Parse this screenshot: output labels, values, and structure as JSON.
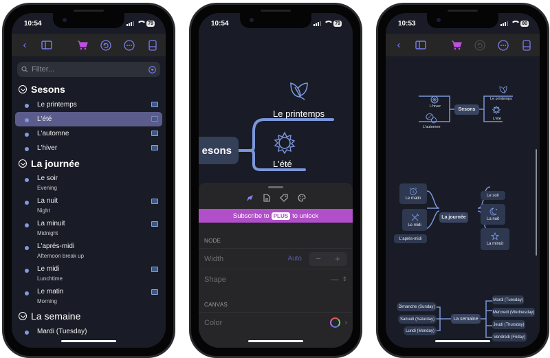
{
  "phones": [
    {
      "status": {
        "time": "10:54",
        "battery": "79"
      },
      "toolbar": {
        "icons": [
          "back-icon",
          "sidebar-icon",
          "cart-icon",
          "undo-icon",
          "more-icon",
          "device-icon"
        ]
      },
      "filter": {
        "placeholder": "Filter..."
      },
      "outline": [
        {
          "title": "Sesons",
          "items": [
            {
              "label": "Le printemps",
              "sub": "",
              "has_image": true
            },
            {
              "label": "L'été",
              "sub": "",
              "has_image": true,
              "selected": true
            },
            {
              "label": "L'automne",
              "sub": "",
              "has_image": true
            },
            {
              "label": "L'hiver",
              "sub": "",
              "has_image": true
            }
          ]
        },
        {
          "title": "La journée",
          "items": [
            {
              "label": "Le soir",
              "sub": "Evening",
              "has_image": false
            },
            {
              "label": "La nuit",
              "sub": "Night",
              "has_image": true
            },
            {
              "label": "La minuit",
              "sub": "Midnight",
              "has_image": true
            },
            {
              "label": "L'aprés-midi",
              "sub": "Afternoon break up",
              "has_image": false
            },
            {
              "label": "Le midi",
              "sub": "Lunchtime",
              "has_image": true
            },
            {
              "label": "Le matin",
              "sub": "Morning",
              "has_image": true
            }
          ]
        },
        {
          "title": "La semaine",
          "items": [
            {
              "label": "Mardi (Tuesday)",
              "sub": "",
              "has_image": false
            }
          ]
        }
      ]
    },
    {
      "status": {
        "time": "10:54",
        "battery": "79"
      },
      "mindmap": {
        "root": "esons",
        "children": [
          {
            "label": "Le printemps",
            "icon": "leaf-icon"
          },
          {
            "label": "L'été",
            "icon": "sun-icon"
          }
        ]
      },
      "sheet": {
        "tabs": [
          "style-icon",
          "document-icon",
          "tag-icon",
          "palette-icon"
        ],
        "banner": {
          "prefix": "Subscribe to",
          "badge": "PLUS",
          "suffix": "to unlock"
        },
        "node_header": "NODE",
        "width_label": "Width",
        "width_value": "Auto",
        "stepper_minus": "−",
        "stepper_plus": "+",
        "shape_label": "Shape",
        "shape_value": "—",
        "canvas_header": "CANVAS",
        "color_label": "Color"
      }
    },
    {
      "status": {
        "time": "10:53",
        "battery": "80"
      },
      "toolbar": {
        "icons": [
          "back-icon",
          "sidebar-icon",
          "cart-icon",
          "undo-icon",
          "more-icon",
          "device-icon"
        ]
      },
      "maps": {
        "sesons": {
          "root": "Sesons",
          "left": [
            "L'hiver",
            "L'automne"
          ],
          "right": [
            "Le printemps",
            "L'été"
          ]
        },
        "journee": {
          "root": "La journée",
          "left": [
            "Le matin",
            "Le midi",
            "L'aprés-midi"
          ],
          "right": [
            "Le soir",
            "La nuit",
            "La minuit"
          ]
        },
        "semaine": {
          "root": "La semaine",
          "left": [
            "Dimanche (Sunday)",
            "Samedi (Saturday)",
            "Lundi (Monday)"
          ],
          "right": [
            "Mardi (Tuesday)",
            "Mercredi (Wednesday)",
            "Jeudi (Thursday)",
            "Vendredi (Friday)"
          ]
        }
      }
    }
  ],
  "colors": {
    "accent": "#7a7ef0",
    "cart": "#c04fe0",
    "banner": "#b04fc8",
    "selected": "#5c5c8c",
    "line": "#7b96da",
    "canvas": "#191c26"
  }
}
